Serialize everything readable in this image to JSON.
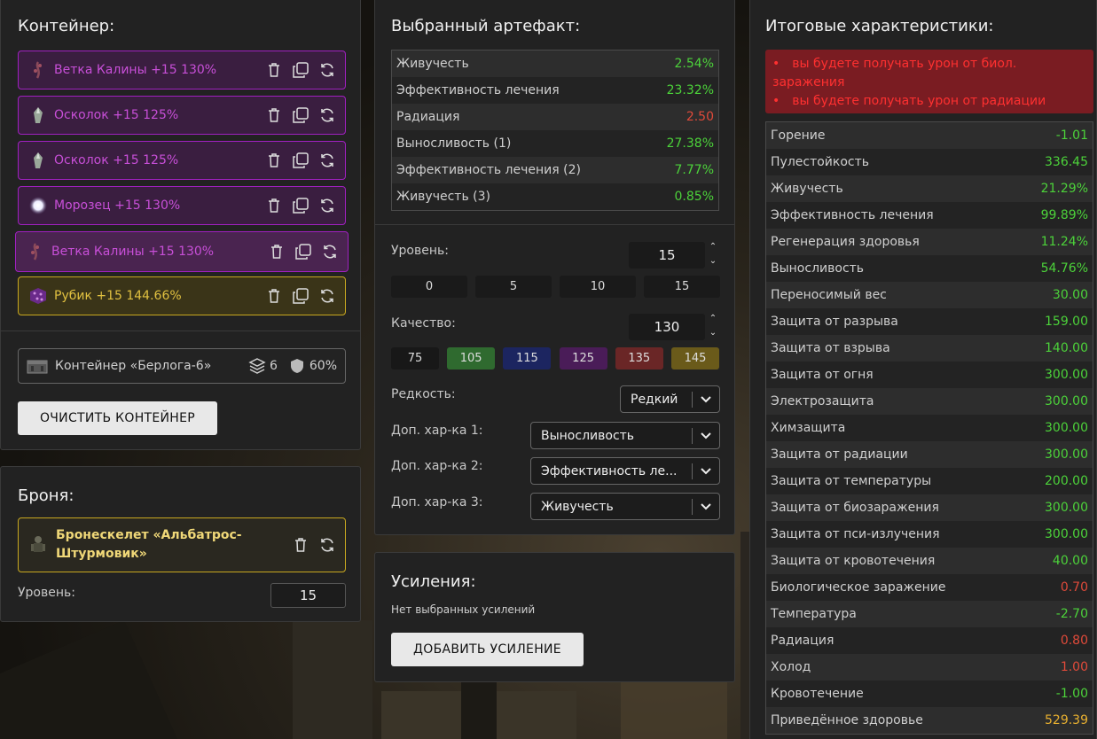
{
  "container": {
    "title": "Контейнер:",
    "slots": [
      {
        "name": "Ветка Калины +15 130%",
        "icon": "viburnum-branch-icon",
        "type": "purple"
      },
      {
        "name": "Осколок +15 125%",
        "icon": "shard-icon",
        "type": "purple"
      },
      {
        "name": "Осколок +15 125%",
        "icon": "shard-icon",
        "type": "purple"
      },
      {
        "name": "Морозец +15 130%",
        "icon": "frost-orb-icon",
        "type": "purple"
      },
      {
        "name": "Ветка Калины +15 130%",
        "icon": "viburnum-branch-icon",
        "type": "purple"
      },
      {
        "name": "Рубик +15 144.66%",
        "icon": "rubik-cube-icon",
        "type": "gold"
      }
    ],
    "box": {
      "name": "Контейнер «Берлога-6»",
      "slots": "6",
      "protection": "60%"
    },
    "clear_button": "ОЧИСТИТЬ КОНТЕЙНЕР"
  },
  "armor": {
    "title": "Броня:",
    "name": "Бронескелет «Альбатрос-Штурмовик»",
    "level_label": "Уровень:",
    "level_value": "15"
  },
  "artifact": {
    "title": "Выбранный артефакт:",
    "stats": [
      {
        "label": "Живучесть",
        "value": "2.54%",
        "color": "g"
      },
      {
        "label": "Эффективность лечения",
        "value": "23.32%",
        "color": "g"
      },
      {
        "label": "Радиация",
        "value": "2.50",
        "color": "r"
      },
      {
        "label": "Выносливость (1)",
        "value": "27.38%",
        "color": "g"
      },
      {
        "label": "Эффективность лечения (2)",
        "value": "7.77%",
        "color": "g"
      },
      {
        "label": "Живучесть (3)",
        "value": "0.85%",
        "color": "g"
      }
    ],
    "level_label": "Уровень:",
    "level_value": "15",
    "level_presets": [
      "0",
      "5",
      "10",
      "15"
    ],
    "quality_label": "Качество:",
    "quality_value": "130",
    "quality_presets": [
      {
        "label": "75",
        "color": "#181818"
      },
      {
        "label": "105",
        "color": "#2f6a2f"
      },
      {
        "label": "115",
        "color": "#1c2560"
      },
      {
        "label": "125",
        "color": "#4a1c58"
      },
      {
        "label": "135",
        "color": "#6a2626"
      },
      {
        "label": "145",
        "color": "#6a5a1a"
      }
    ],
    "rarity_label": "Редкость:",
    "rarity_value": "Редкий",
    "extra1_label": "Доп. хар-ка 1:",
    "extra1_value": "Выносливость",
    "extra2_label": "Доп. хар-ка 2:",
    "extra2_value": "Эффективность ле...",
    "extra3_label": "Доп. хар-ка 3:",
    "extra3_value": "Живучесть"
  },
  "boosts": {
    "title": "Усиления:",
    "empty": "Нет выбранных усилений",
    "add_button": "ДОБАВИТЬ УСИЛЕНИЕ"
  },
  "totals": {
    "title": "Итоговые характеристики:",
    "warnings": [
      "вы будете получать урон от биол. заражения",
      "вы будете получать урон от радиации"
    ],
    "stats": [
      {
        "label": "Горение",
        "value": "-1.01",
        "color": "g"
      },
      {
        "label": "Пулестойкость",
        "value": "336.45",
        "color": "g"
      },
      {
        "label": "Живучесть",
        "value": "21.29%",
        "color": "g"
      },
      {
        "label": "Эффективность лечения",
        "value": "99.89%",
        "color": "g"
      },
      {
        "label": "Регенерация здоровья",
        "value": "11.24%",
        "color": "g"
      },
      {
        "label": "Выносливость",
        "value": "54.76%",
        "color": "g"
      },
      {
        "label": "Переносимый вес",
        "value": "30.00",
        "color": "g"
      },
      {
        "label": "Защита от разрыва",
        "value": "159.00",
        "color": "g"
      },
      {
        "label": "Защита от взрыва",
        "value": "140.00",
        "color": "g"
      },
      {
        "label": "Защита от огня",
        "value": "300.00",
        "color": "g"
      },
      {
        "label": "Электрозащита",
        "value": "300.00",
        "color": "g"
      },
      {
        "label": "Химзащита",
        "value": "300.00",
        "color": "g"
      },
      {
        "label": "Защита от радиации",
        "value": "300.00",
        "color": "g"
      },
      {
        "label": "Защита от температуры",
        "value": "200.00",
        "color": "g"
      },
      {
        "label": "Защита от биозаражения",
        "value": "300.00",
        "color": "g"
      },
      {
        "label": "Защита от пси-излучения",
        "value": "300.00",
        "color": "g"
      },
      {
        "label": "Защита от кровотечения",
        "value": "40.00",
        "color": "g"
      },
      {
        "label": "Биологическое заражение",
        "value": "0.70",
        "color": "r"
      },
      {
        "label": "Температура",
        "value": "-2.70",
        "color": "g"
      },
      {
        "label": "Радиация",
        "value": "0.80",
        "color": "r"
      },
      {
        "label": "Холод",
        "value": "1.00",
        "color": "r"
      },
      {
        "label": "Кровотечение",
        "value": "-1.00",
        "color": "g"
      },
      {
        "label": "Приведённое здоровье",
        "value": "529.39",
        "color": "o"
      }
    ]
  }
}
